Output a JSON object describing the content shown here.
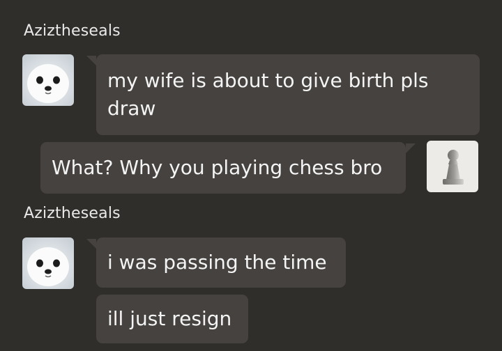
{
  "messages": [
    {
      "sender": "Aziztheseals",
      "lines": [
        "my wife is about to give birth pls",
        "draw"
      ]
    },
    {
      "sender": "self",
      "text": "What? Why you playing chess bro"
    },
    {
      "sender": "Aziztheseals",
      "lines": [
        "i was passing the time",
        "ill just resign"
      ]
    }
  ],
  "avatars": {
    "other": "seal-avatar-icon",
    "self": "pawn-avatar-icon"
  },
  "colors": {
    "background": "#302e2b",
    "bubble": "#45423f",
    "text": "#f4f4f4"
  }
}
